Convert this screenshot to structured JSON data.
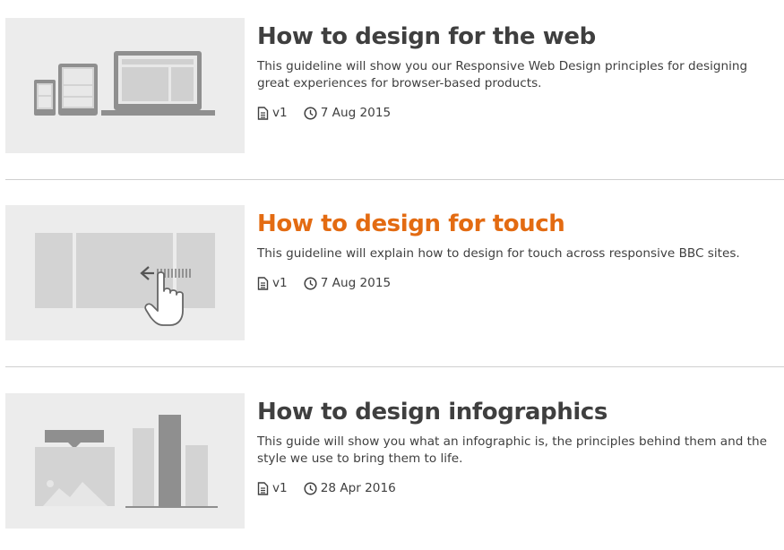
{
  "articles": [
    {
      "title": "How to design for the web",
      "description": "This guideline will show you our Responsive Web Design principles for designing great experiences for browser-based products.",
      "version": "v1",
      "date": "7 Aug 2015",
      "thumbnail_icon": "responsive-devices-illustration",
      "state": "default"
    },
    {
      "title": "How to design for touch",
      "description": "This guideline will explain how to design for touch across responsive BBC sites.",
      "version": "v1",
      "date": "7 Aug 2015",
      "thumbnail_icon": "touch-swipe-illustration",
      "state": "hover"
    },
    {
      "title": "How to design infographics",
      "description": "This guide will show you what an infographic is, the principles behind them and the style we use to bring them to life.",
      "version": "v1",
      "date": "28 Apr 2016",
      "thumbnail_icon": "infographic-illustration",
      "state": "default"
    }
  ],
  "colors": {
    "text": "#3f3f3f",
    "accent": "#e36b12",
    "thumb_bg": "#ececec",
    "divider": "#cfcfcf"
  }
}
